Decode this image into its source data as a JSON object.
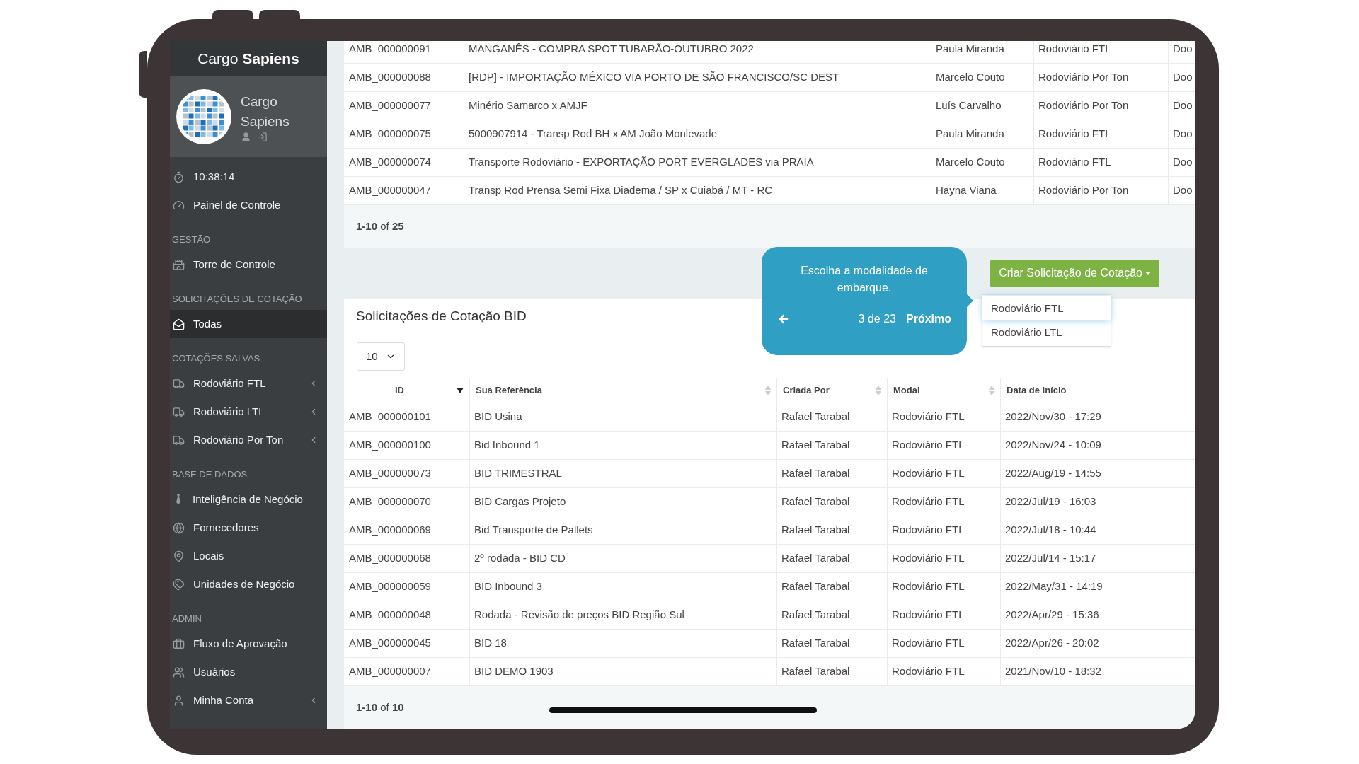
{
  "sidebar": {
    "brand": "Cargo **Sapiens**",
    "profile_name": "Cargo Sapiens",
    "sections": [
      {
        "items": [
          {
            "label": "10:38:14",
            "selected": false,
            "expandable": false
          },
          {
            "label": "Painel de Controle",
            "selected": false,
            "expandable": false
          }
        ]
      },
      {
        "heading": "GESTÃO",
        "items": [
          {
            "label": "Torre de Controle",
            "selected": false,
            "expandable": false
          }
        ]
      },
      {
        "heading": "SOLICITAÇÕES DE COTAÇÃO",
        "items": [
          {
            "label": "Todas",
            "selected": true,
            "expandable": false
          }
        ]
      },
      {
        "heading": "COTAÇÕES SALVAS",
        "items": [
          {
            "label": "Rodoviário FTL",
            "selected": false,
            "expandable": true
          },
          {
            "label": "Rodoviário LTL",
            "selected": false,
            "expandable": true
          },
          {
            "label": "Rodoviário Por Ton",
            "selected": false,
            "expandable": true
          }
        ]
      },
      {
        "heading": "BASE DE DADOS",
        "items": [
          {
            "label": "Inteligência de Negócio",
            "selected": false,
            "expandable": false
          },
          {
            "label": "Fornecedores",
            "selected": false,
            "expandable": false
          },
          {
            "label": "Locais",
            "selected": false,
            "expandable": false
          },
          {
            "label": "Unidades de Negócio",
            "selected": false,
            "expandable": false
          }
        ]
      },
      {
        "heading": "ADMIN",
        "items": [
          {
            "label": "Fluxo de Aprovação",
            "selected": false,
            "expandable": false
          },
          {
            "label": "Usuários",
            "selected": false,
            "expandable": false
          },
          {
            "label": "Minha Conta",
            "selected": false,
            "expandable": true
          }
        ]
      }
    ]
  },
  "top_table": {
    "rows": [
      [
        "AMB_000000091",
        "MANGANÊS - COMPRA SPOT TUBARÃO-OUTUBRO 2022",
        "Paula Miranda",
        "Rodoviário FTL",
        "Doo"
      ],
      [
        "AMB_000000088",
        "[RDP] - IMPORTAÇÃO MÉXICO VIA PORTO DE SÃO FRANCISCO/SC DEST",
        "Marcelo Couto",
        "Rodoviário Por Ton",
        "Doo"
      ],
      [
        "AMB_000000077",
        "Minério Samarco x AMJF",
        "Luís Carvalho",
        "Rodoviário Por Ton",
        "Doo"
      ],
      [
        "AMB_000000075",
        "5000907914 - Transp Rod BH x AM João Monlevade",
        "Paula Miranda",
        "Rodoviário FTL",
        "Doo"
      ],
      [
        "AMB_000000074",
        "Transporte Rodoviário - EXPORTAÇÃO PORT EVERGLADES via PRAIA",
        "Marcelo Couto",
        "Rodoviário FTL",
        "Doo"
      ],
      [
        "AMB_000000047",
        "Transp Rod Prensa Semi Fixa Diadema / SP x Cuiabá / MT - RC",
        "Hayna Viana",
        "Rodoviário Por Ton",
        "Doo"
      ]
    ],
    "pagination": "**1-10** of **25**"
  },
  "create_button": {
    "label": "Criar Solicitação de Cotação",
    "options": [
      {
        "label": "Rodoviário FTL",
        "selected": true
      },
      {
        "label": "Rodoviário LTL",
        "selected": false
      }
    ]
  },
  "tour_tooltip": {
    "text": "Escolha a modalidade de embarque.",
    "step": "3 de 23",
    "next": "Próximo"
  },
  "bid_table": {
    "title": "Solicitações de Cotação BID",
    "page_size": "10",
    "columns": [
      {
        "label": "ID",
        "sortable": true,
        "sorted": true
      },
      {
        "label": "Sua Referência",
        "sortable": true,
        "sorted": false
      },
      {
        "label": "Criada Por",
        "sortable": true,
        "sorted": false
      },
      {
        "label": "Modal",
        "sortable": true,
        "sorted": false
      },
      {
        "label": "Data de Início",
        "sortable": false,
        "sorted": false
      }
    ],
    "rows": [
      [
        "AMB_000000101",
        "BID Usina",
        "Rafael Tarabal",
        "Rodoviário FTL",
        "2022/Nov/30 - 17:29"
      ],
      [
        "AMB_000000100",
        "Bid Inbound 1",
        "Rafael Tarabal",
        "Rodoviário FTL",
        "2022/Nov/24 - 10:09"
      ],
      [
        "AMB_000000073",
        "BID TRIMESTRAL",
        "Rafael Tarabal",
        "Rodoviário FTL",
        "2022/Aug/19 - 14:55"
      ],
      [
        "AMB_000000070",
        "BID Cargas Projeto",
        "Rafael Tarabal",
        "Rodoviário FTL",
        "2022/Jul/19 - 16:03"
      ],
      [
        "AMB_000000069",
        "Bid Transporte de Pallets",
        "Rafael Tarabal",
        "Rodoviário FTL",
        "2022/Jul/18 - 10:44"
      ],
      [
        "AMB_000000068",
        "2º rodada - BID CD",
        "Rafael Tarabal",
        "Rodoviário FTL",
        "2022/Jul/14 - 15:17"
      ],
      [
        "AMB_000000059",
        "BID Inbound 3",
        "Rafael Tarabal",
        "Rodoviário FTL",
        "2022/May/31 - 14:19"
      ],
      [
        "AMB_000000048",
        "Rodada - Revisão de preços BID Região Sul",
        "Rafael Tarabal",
        "Rodoviário FTL",
        "2022/Apr/29 - 15:36"
      ],
      [
        "AMB_000000045",
        "BID 18",
        "Rafael Tarabal",
        "Rodoviário FTL",
        "2022/Apr/26 - 20:02"
      ],
      [
        "AMB_000000007",
        "BID DEMO 1903",
        "Rafael Tarabal",
        "Rodoviário FTL",
        "2021/Nov/10 - 18:32"
      ]
    ],
    "pagination": "**1-10** of **10**"
  }
}
